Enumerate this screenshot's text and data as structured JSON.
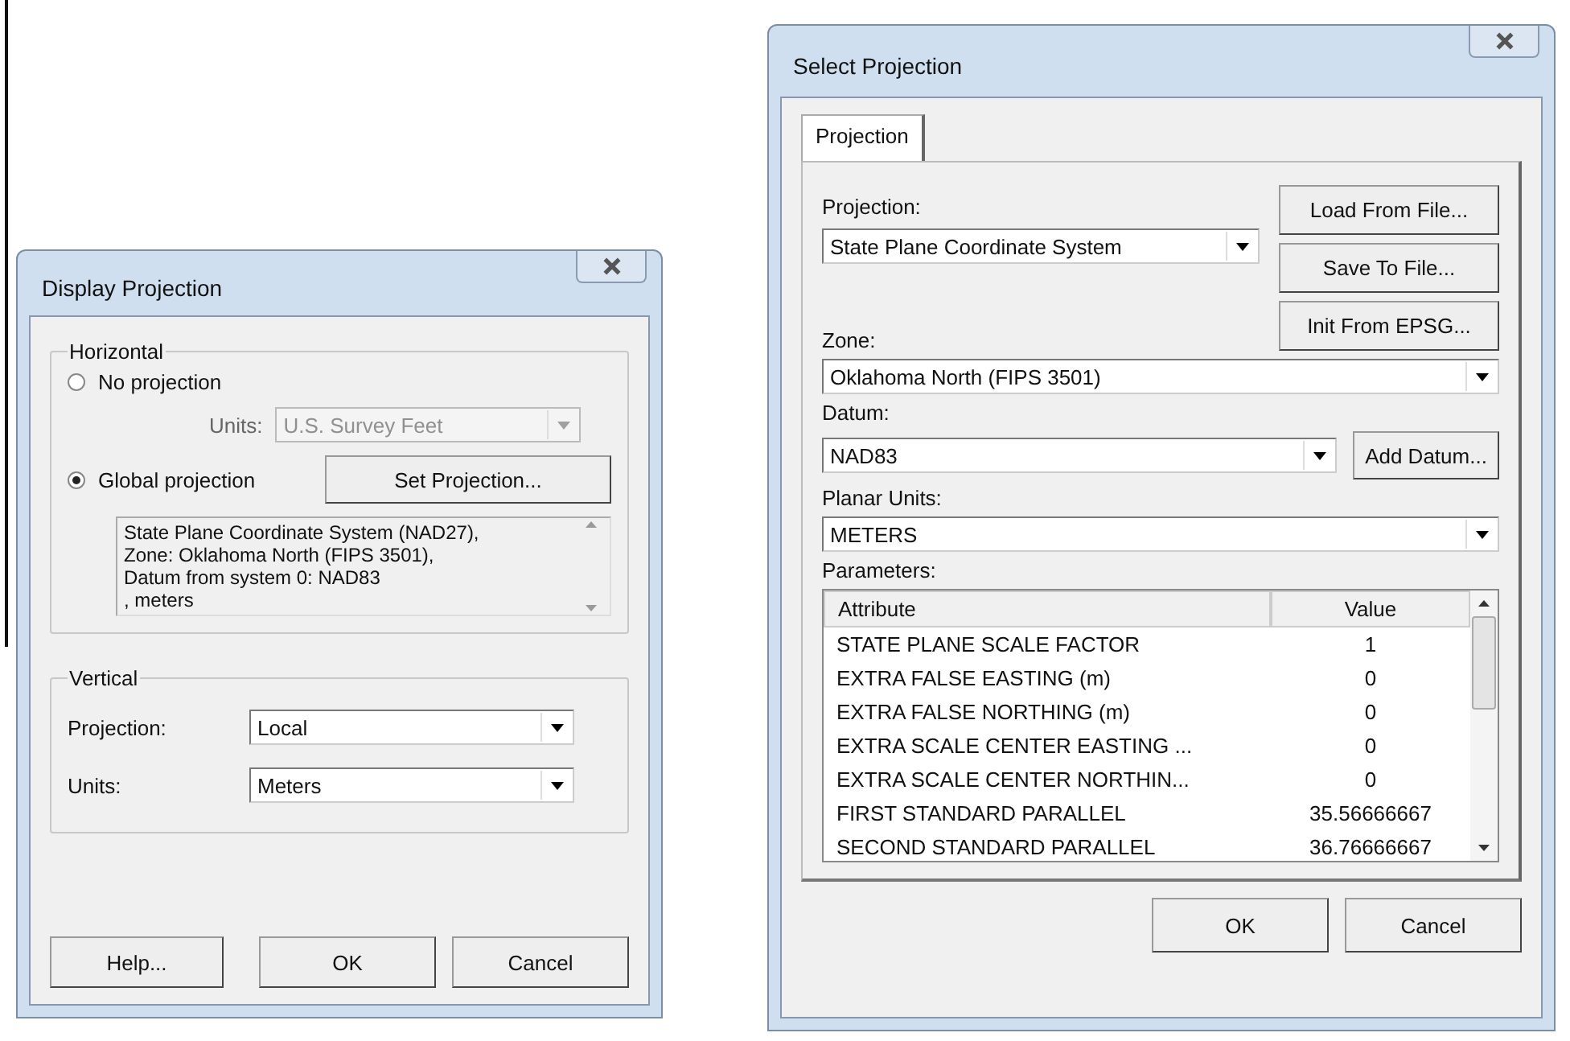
{
  "display_dialog": {
    "title": "Display Projection",
    "horizontal": {
      "legend": "Horizontal",
      "options": [
        {
          "label": "No projection",
          "selected": false
        },
        {
          "label": "Global projection",
          "selected": true
        }
      ],
      "units": {
        "label": "Units:",
        "value": "U.S. Survey Feet",
        "disabled": true
      },
      "set_button": "Set Projection...",
      "description": [
        "State Plane Coordinate System (NAD27),",
        "Zone: Oklahoma North (FIPS 3501),",
        "Datum from system 0: NAD83",
        ", meters"
      ]
    },
    "vertical": {
      "legend": "Vertical",
      "fields": [
        {
          "label": "Projection:",
          "value": "Local"
        },
        {
          "label": "Units:",
          "value": "Meters"
        }
      ]
    },
    "buttons": [
      "Help...",
      "OK",
      "Cancel"
    ]
  },
  "select_dialog": {
    "title": "Select Projection",
    "tabs": [
      {
        "label": "Projection",
        "selected": true
      }
    ],
    "projection": {
      "label": "Projection:",
      "value": "State Plane Coordinate System"
    },
    "side_buttons": [
      "Load From File...",
      "Save To File...",
      "Init From EPSG..."
    ],
    "zone": {
      "label": "Zone:",
      "value": "Oklahoma North (FIPS 3501)"
    },
    "datum": {
      "label": "Datum:",
      "value": "NAD83",
      "button": "Add Datum..."
    },
    "planar_units": {
      "label": "Planar Units:",
      "value": "METERS"
    },
    "parameters": {
      "label": "Parameters:",
      "columns": [
        "Attribute",
        "Value"
      ],
      "rows": [
        [
          "STATE PLANE SCALE FACTOR",
          "1"
        ],
        [
          "EXTRA FALSE EASTING (m)",
          "0"
        ],
        [
          "EXTRA FALSE NORTHING (m)",
          "0"
        ],
        [
          "EXTRA SCALE CENTER EASTING ...",
          "0"
        ],
        [
          "EXTRA SCALE CENTER NORTHIN...",
          "0"
        ],
        [
          "FIRST STANDARD PARALLEL",
          "35.56666667"
        ],
        [
          "SECOND STANDARD PARALLEL",
          "36.76666667"
        ]
      ]
    },
    "buttons": [
      "OK",
      "Cancel"
    ]
  }
}
